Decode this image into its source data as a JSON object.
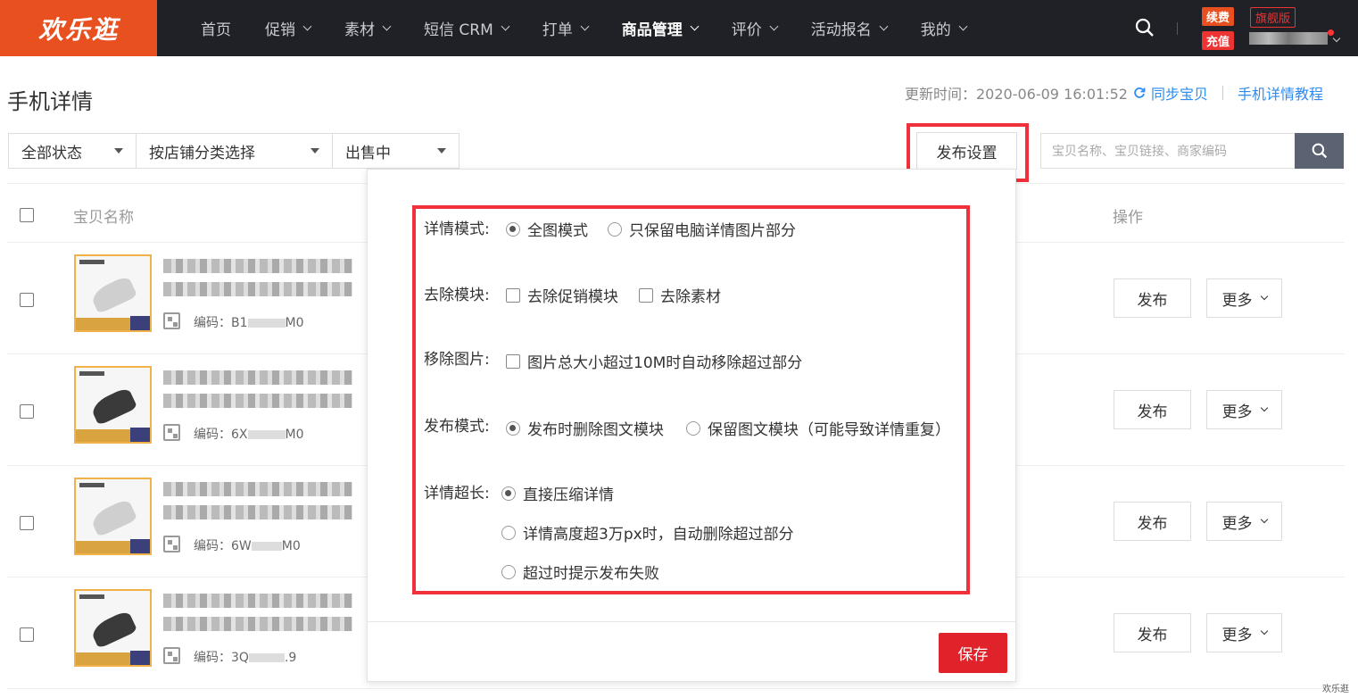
{
  "brand": {
    "logo_text": "欢乐逛",
    "accent": "#e8501f"
  },
  "nav": {
    "items": [
      {
        "label": "首页",
        "dropdown": false,
        "active": false
      },
      {
        "label": "促销",
        "dropdown": true,
        "active": false
      },
      {
        "label": "素材",
        "dropdown": true,
        "active": false
      },
      {
        "label": "短信 CRM",
        "dropdown": true,
        "active": false
      },
      {
        "label": "打单",
        "dropdown": true,
        "active": false
      },
      {
        "label": "商品管理",
        "dropdown": true,
        "active": true
      },
      {
        "label": "评价",
        "dropdown": true,
        "active": false
      },
      {
        "label": "活动报名",
        "dropdown": true,
        "active": false
      },
      {
        "label": "我的",
        "dropdown": true,
        "active": false
      }
    ]
  },
  "account": {
    "renew_label": "续费",
    "edition_label": "旗舰版",
    "recharge_label": "充值"
  },
  "page": {
    "title": "手机详情",
    "update_label": "更新时间：2020-06-09 16:01:52",
    "sync_label": "同步宝贝",
    "tutorial_label": "手机详情教程"
  },
  "filters": {
    "status": "全部状态",
    "category": "按店铺分类选择",
    "sale_state": "出售中"
  },
  "publish_settings_button": "发布设置",
  "search": {
    "placeholder": "宝贝名称、宝贝链接、商家编码"
  },
  "table": {
    "col_name": "宝贝名称",
    "col_action": "操作",
    "code_prefix": "编码：",
    "publish_label": "发布",
    "more_label": "更多",
    "rows": [
      {
        "code_start": "B1",
        "code_end": "M0",
        "thumb_dark": false
      },
      {
        "code_start": "6X",
        "code_end": "M0",
        "thumb_dark": true
      },
      {
        "code_start": "6W",
        "code_end": "M0",
        "thumb_dark": false
      },
      {
        "code_start": "3Q",
        "code_end": ".9",
        "thumb_dark": true
      }
    ]
  },
  "settings_panel": {
    "detail_mode": {
      "label": "详情模式:",
      "options": [
        "全图模式",
        "只保留电脑详情图片部分"
      ],
      "selected": 0
    },
    "remove_module": {
      "label": "去除模块:",
      "options": [
        "去除促销模块",
        "去除素材"
      ]
    },
    "remove_image": {
      "label": "移除图片:",
      "option": "图片总大小超过10M时自动移除超过部分"
    },
    "publish_mode": {
      "label": "发布模式:",
      "options": [
        "发布时删除图文模块",
        "保留图文模块（可能导致详情重复）"
      ],
      "selected": 0
    },
    "detail_overlong": {
      "label": "详情超长:",
      "options": [
        "直接压缩详情",
        "详情高度超3万px时，自动删除超过部分",
        "超过时提示发布失败"
      ],
      "selected": 0
    },
    "save_label": "保存"
  },
  "watermark": "欢乐逛"
}
